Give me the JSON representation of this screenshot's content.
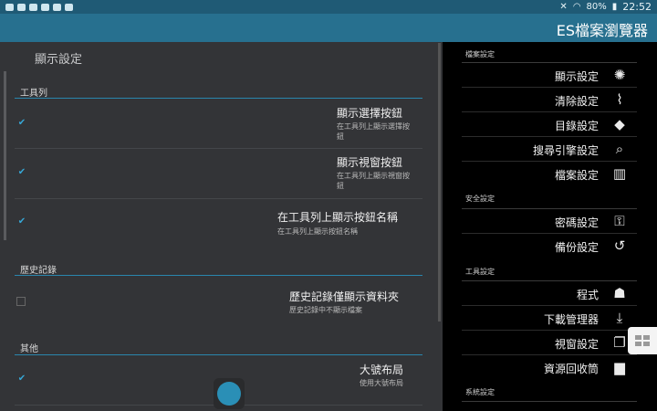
{
  "status_bar": {
    "battery": "80%",
    "time": "22:52"
  },
  "app": {
    "title": "ES檔案瀏覽器"
  },
  "settings": {
    "title": "顯示設定",
    "sections": [
      {
        "header": "工具列",
        "items": [
          {
            "title": "顯示選擇按鈕",
            "subtitle": "在工具列上顯示選擇按鈕",
            "checked": true
          },
          {
            "title": "顯示視窗按鈕",
            "subtitle": "在工具列上顯示視窗按鈕",
            "checked": true
          },
          {
            "title": "在工具列上顯示按鈕名稱",
            "subtitle": "在工具列上顯示按鈕名稱",
            "checked": true
          }
        ]
      },
      {
        "header": "歷史記錄",
        "items": [
          {
            "title": "歷史記錄僅顯示資料夾",
            "subtitle": "歷史記錄中不顯示檔案",
            "checked": false
          }
        ]
      },
      {
        "header": "其他",
        "items": [
          {
            "title": "大號布局",
            "subtitle": "使用大號布局",
            "checked": true
          }
        ]
      }
    ]
  },
  "menu": {
    "sections": [
      {
        "header": "檔案設定",
        "items": [
          {
            "label": "顯示設定",
            "icon": "display-brightness-icon"
          },
          {
            "label": "清除設定",
            "icon": "broom-icon"
          },
          {
            "label": "目錄設定",
            "icon": "directions-icon"
          },
          {
            "label": "搜尋引擎設定",
            "icon": "search-icon"
          },
          {
            "label": "檔案設定",
            "icon": "book-icon"
          }
        ]
      },
      {
        "header": "安全設定",
        "items": [
          {
            "label": "密碼設定",
            "icon": "key-icon"
          },
          {
            "label": "備份設定",
            "icon": "history-icon"
          }
        ]
      },
      {
        "header": "工具設定",
        "items": [
          {
            "label": "程式",
            "icon": "android-icon"
          },
          {
            "label": "下載管理器",
            "icon": "download-icon"
          },
          {
            "label": "視窗設定",
            "icon": "windows-icon"
          },
          {
            "label": "資源回收筒",
            "icon": "trash-icon"
          }
        ]
      },
      {
        "header": "系統設定",
        "items": []
      }
    ]
  },
  "colors": {
    "status_bar": "#1f5a75",
    "action_bar": "#27708f",
    "accent": "#36a7d6",
    "left_pane_bg": "#333437"
  }
}
